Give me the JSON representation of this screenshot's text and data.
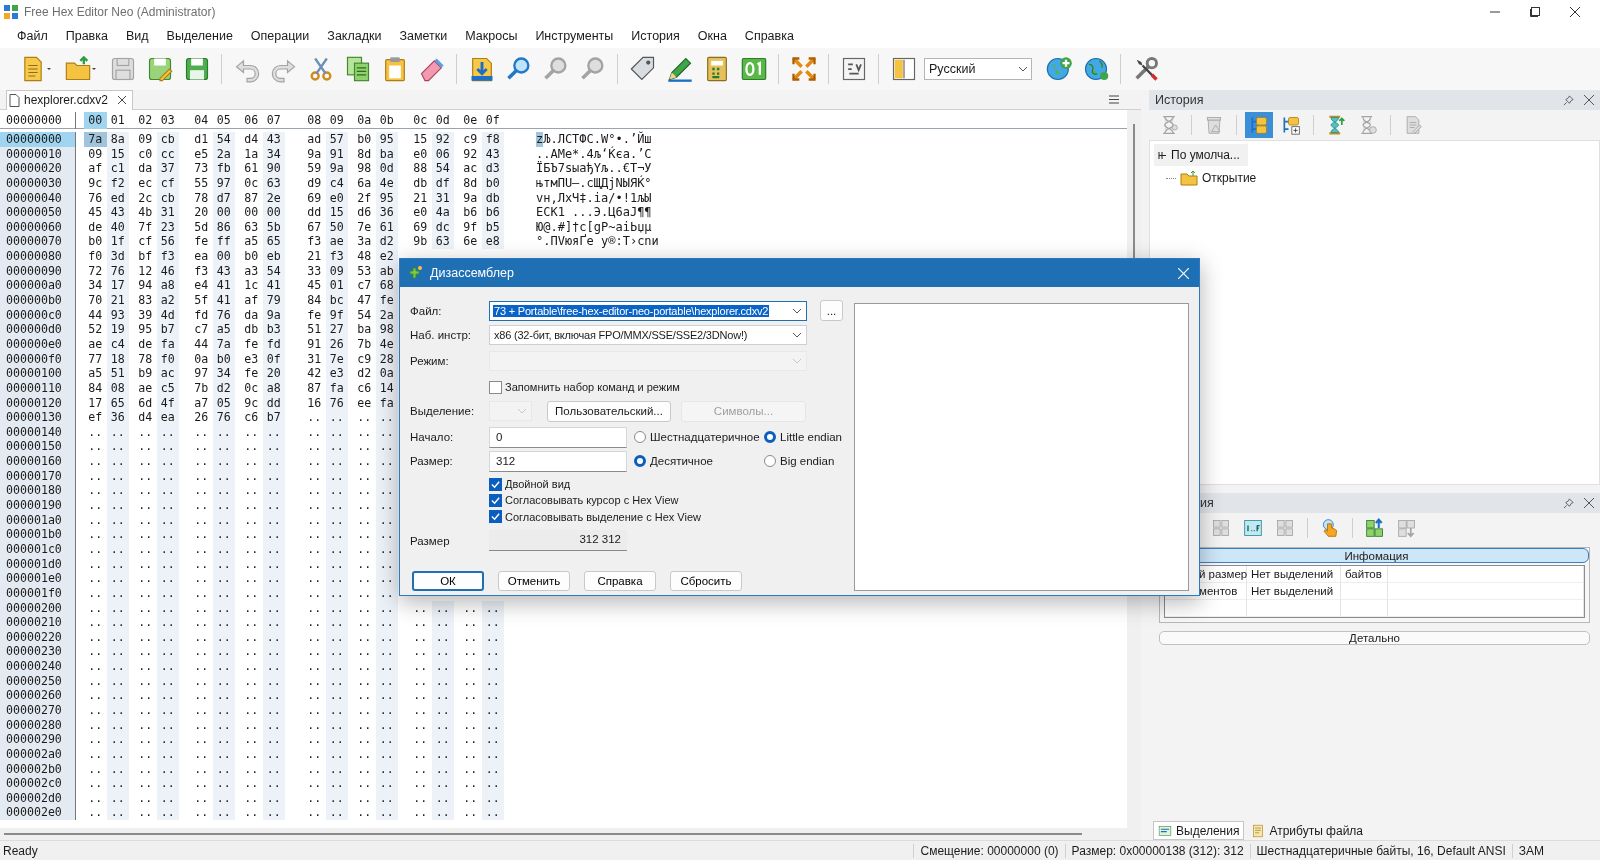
{
  "window": {
    "title": "Free Hex Editor Neo (Administrator)"
  },
  "menu": [
    "Файл",
    "Правка",
    "Вид",
    "Выделение",
    "Операции",
    "Закладки",
    "Заметки",
    "Макросы",
    "Инструменты",
    "История",
    "Окна",
    "Справка"
  ],
  "toolbar": {
    "groups": [
      [
        {
          "kind": "new",
          "disabled": false
        },
        {
          "kind": "caret",
          "disabled": false
        },
        {
          "kind": "open",
          "disabled": false
        },
        {
          "kind": "caret",
          "disabled": false
        },
        {
          "kind": "save",
          "disabled": true
        },
        {
          "kind": "saveas",
          "disabled": false
        },
        {
          "kind": "saveall",
          "disabled": false
        }
      ],
      [
        {
          "kind": "undo",
          "disabled": true
        },
        {
          "kind": "redo",
          "disabled": true
        },
        {
          "kind": "scissors",
          "disabled": false
        },
        {
          "kind": "copy",
          "disabled": false
        },
        {
          "kind": "paste",
          "disabled": false
        },
        {
          "kind": "eraser",
          "disabled": false
        }
      ],
      [
        {
          "kind": "import",
          "disabled": false
        },
        {
          "kind": "search",
          "disabled": false
        },
        {
          "kind": "searchnext",
          "disabled": true
        },
        {
          "kind": "searchprev",
          "disabled": true
        }
      ],
      [
        {
          "kind": "tag",
          "disabled": false
        },
        {
          "kind": "pencil",
          "disabled": false
        },
        {
          "kind": "calculator",
          "disabled": false
        },
        {
          "kind": "binary",
          "disabled": false
        }
      ],
      [
        {
          "kind": "arrows",
          "disabled": false
        }
      ],
      [
        {
          "kind": "figure",
          "disabled": false
        }
      ],
      [
        {
          "kind": "panel",
          "disabled": false
        },
        {
          "kind": "language",
          "disabled": false
        },
        {
          "kind": "globeplus",
          "disabled": false
        },
        {
          "kind": "globe",
          "disabled": false
        }
      ],
      [
        {
          "kind": "tools",
          "disabled": false
        }
      ]
    ],
    "language": "Русский"
  },
  "document_tab": {
    "label": "hexplorer.cdxv2"
  },
  "hex_view": {
    "corner": "00000000",
    "columns": [
      {
        "label": "00",
        "selected": true
      },
      {
        "label": "01",
        "selected": false
      },
      {
        "label": "02",
        "selected": false
      },
      {
        "label": "03",
        "selected": false
      },
      {
        "label": "04",
        "selected": false
      },
      {
        "label": "05",
        "selected": false
      },
      {
        "label": "06",
        "selected": false
      },
      {
        "label": "07",
        "selected": false
      },
      {
        "label": "08",
        "selected": false
      },
      {
        "label": "09",
        "selected": false
      },
      {
        "label": "0a",
        "selected": false
      },
      {
        "label": "0b",
        "selected": false
      },
      {
        "label": "0c",
        "selected": false
      },
      {
        "label": "0d",
        "selected": false
      },
      {
        "label": "0e",
        "selected": false
      },
      {
        "label": "0f",
        "selected": false
      }
    ],
    "rows": [
      {
        "address": "00000000",
        "selected": true,
        "bytes": [
          "7a",
          "8a",
          "09",
          "cb",
          "d1",
          "54",
          "d4",
          "43",
          "ad",
          "57",
          "b0",
          "95",
          "15",
          "92",
          "c9",
          "f8"
        ],
        "text": "zЉ.ЛСТФС.W°•.’Йш"
      },
      {
        "address": "00000010",
        "selected": false,
        "bytes": [
          "09",
          "15",
          "c0",
          "cc",
          "e5",
          "2a",
          "1a",
          "34",
          "9a",
          "91",
          "8d",
          "ba",
          "e0",
          "06",
          "92",
          "43"
        ],
        "text": "..АМе*.4љ‘Ќєa.’C"
      },
      {
        "address": "00000020",
        "selected": false,
        "bytes": [
          "af",
          "c1",
          "da",
          "37",
          "73",
          "fb",
          "61",
          "90",
          "59",
          "9a",
          "98",
          "0d",
          "88",
          "54",
          "ac",
          "d3"
        ],
        "text": "ЇБЪ7sыaђYљ..€Т¬У"
      },
      {
        "address": "00000030",
        "selected": false,
        "bytes": [
          "9c",
          "f2",
          "ec",
          "cf",
          "55",
          "97",
          "0c",
          "63",
          "d9",
          "c4",
          "6a",
          "4e",
          "db",
          "df",
          "8d",
          "b0"
        ],
        "text": "њтмПU–.cЩДjNЫЯЌ°"
      },
      {
        "address": "00000040",
        "selected": false,
        "bytes": [
          "76",
          "ed",
          "2c",
          "cb",
          "78",
          "d7",
          "87",
          "2e",
          "69",
          "e0",
          "2f",
          "95",
          "21",
          "31",
          "9a",
          "db"
        ],
        "text": "vн,ЛхЧ‡.ia/•!1љЫ"
      },
      {
        "address": "00000050",
        "selected": false,
        "bytes": [
          "45",
          "43",
          "4b",
          "31",
          "20",
          "00",
          "00",
          "00",
          "dd",
          "15",
          "d6",
          "36",
          "e0",
          "4a",
          "b6",
          "b6"
        ],
        "text": "ECK1 ...Э.Ц6aJ¶¶"
      },
      {
        "address": "00000060",
        "selected": false,
        "bytes": [
          "de",
          "40",
          "7f",
          "23",
          "5d",
          "86",
          "63",
          "5b",
          "67",
          "50",
          "7e",
          "61",
          "69",
          "dc",
          "9f",
          "b5"
        ],
        "text": "Ю@.#]†c[gP~aiЬџµ"
      },
      {
        "address": "00000070",
        "selected": false,
        "bytes": [
          "b0",
          "1f",
          "cf",
          "56",
          "fe",
          "ff",
          "a5",
          "65",
          "f3",
          "ae",
          "3a",
          "d2",
          "9b",
          "63",
          "6e",
          "e8"
        ],
        "text": "°.ПVюяҐe у®:Т›cnи"
      },
      {
        "address": "00000080",
        "selected": false,
        "bytes": [
          "f0",
          "3d",
          "bf",
          "f3",
          "ea",
          "00",
          "b0",
          "eb",
          "21",
          "f3",
          "48",
          "e2"
        ]
      },
      {
        "address": "00000090",
        "selected": false,
        "bytes": [
          "72",
          "76",
          "12",
          "46",
          "f3",
          "43",
          "a3",
          "54",
          "33",
          "09",
          "53",
          "ab"
        ]
      },
      {
        "address": "000000a0",
        "selected": false,
        "bytes": [
          "34",
          "17",
          "94",
          "a8",
          "e4",
          "41",
          "1c",
          "41",
          "45",
          "01",
          "c7",
          "68"
        ]
      },
      {
        "address": "000000b0",
        "selected": false,
        "bytes": [
          "70",
          "21",
          "83",
          "a2",
          "5f",
          "41",
          "af",
          "79",
          "84",
          "bc",
          "47",
          "fe"
        ]
      },
      {
        "address": "000000c0",
        "selected": false,
        "bytes": [
          "44",
          "93",
          "39",
          "4d",
          "fd",
          "76",
          "da",
          "9a",
          "fe",
          "9f",
          "54",
          "2a"
        ]
      },
      {
        "address": "000000d0",
        "selected": false,
        "bytes": [
          "52",
          "19",
          "95",
          "b7",
          "c7",
          "a5",
          "db",
          "b3",
          "51",
          "27",
          "ba",
          "98"
        ]
      },
      {
        "address": "000000e0",
        "selected": false,
        "bytes": [
          "ae",
          "c4",
          "de",
          "fa",
          "44",
          "7a",
          "fe",
          "fd",
          "91",
          "26",
          "7b",
          "4e"
        ]
      },
      {
        "address": "000000f0",
        "selected": false,
        "bytes": [
          "77",
          "18",
          "78",
          "f0",
          "0a",
          "b0",
          "e3",
          "0f",
          "31",
          "7e",
          "c9",
          "28"
        ]
      },
      {
        "address": "00000100",
        "selected": false,
        "bytes": [
          "a5",
          "51",
          "b9",
          "ac",
          "97",
          "34",
          "fe",
          "20",
          "42",
          "e3",
          "d2",
          "0a"
        ]
      },
      {
        "address": "00000110",
        "selected": false,
        "bytes": [
          "84",
          "08",
          "ae",
          "c5",
          "7b",
          "d2",
          "0c",
          "a8",
          "87",
          "fa",
          "c6",
          "14"
        ]
      },
      {
        "address": "00000120",
        "selected": false,
        "bytes": [
          "17",
          "65",
          "6d",
          "4f",
          "a7",
          "05",
          "9c",
          "dd",
          "16",
          "76",
          "ee",
          "fa"
        ]
      },
      {
        "address": "00000130",
        "selected": false,
        "bytes": [
          "ef",
          "36",
          "d4",
          "ea",
          "26",
          "76",
          "c6",
          "b7",
          "..",
          "..",
          "..",
          ".."
        ]
      },
      {
        "address": "00000140",
        "selected": false,
        "bytes": [
          "..",
          "..",
          "..",
          "..",
          "..",
          "..",
          "..",
          "..",
          "..",
          "..",
          "..",
          ".."
        ]
      },
      {
        "address": "00000150",
        "selected": false,
        "bytes": [
          "..",
          "..",
          "..",
          "..",
          "..",
          "..",
          "..",
          "..",
          "..",
          "..",
          "..",
          ".."
        ]
      },
      {
        "address": "00000160",
        "selected": false,
        "bytes": [
          "..",
          "..",
          "..",
          "..",
          "..",
          "..",
          "..",
          "..",
          "..",
          "..",
          "..",
          ".."
        ]
      },
      {
        "address": "00000170",
        "selected": false,
        "bytes": [
          "..",
          "..",
          "..",
          "..",
          "..",
          "..",
          "..",
          "..",
          "..",
          "..",
          "..",
          ".."
        ]
      },
      {
        "address": "00000180",
        "selected": false,
        "bytes": [
          "..",
          "..",
          "..",
          "..",
          "..",
          "..",
          "..",
          "..",
          "..",
          "..",
          "..",
          ".."
        ]
      },
      {
        "address": "00000190",
        "selected": false,
        "bytes": [
          "..",
          "..",
          "..",
          "..",
          "..",
          "..",
          "..",
          "..",
          "..",
          "..",
          "..",
          ".."
        ]
      },
      {
        "address": "000001a0",
        "selected": false,
        "bytes": [
          "..",
          "..",
          "..",
          "..",
          "..",
          "..",
          "..",
          "..",
          "..",
          "..",
          "..",
          ".."
        ]
      },
      {
        "address": "000001b0",
        "selected": false,
        "bytes": [
          "..",
          "..",
          "..",
          "..",
          "..",
          "..",
          "..",
          "..",
          "..",
          "..",
          "..",
          ".."
        ]
      },
      {
        "address": "000001c0",
        "selected": false,
        "bytes": [
          "..",
          "..",
          "..",
          "..",
          "..",
          "..",
          "..",
          "..",
          "..",
          "..",
          "..",
          ".."
        ]
      },
      {
        "address": "000001d0",
        "selected": false,
        "bytes": [
          "..",
          "..",
          "..",
          "..",
          "..",
          "..",
          "..",
          "..",
          "..",
          "..",
          "..",
          ".."
        ]
      },
      {
        "address": "000001e0",
        "selected": false,
        "bytes": [
          "..",
          "..",
          "..",
          "..",
          "..",
          "..",
          "..",
          "..",
          "..",
          "..",
          "..",
          ".."
        ]
      },
      {
        "address": "000001f0",
        "selected": false,
        "bytes": [
          "..",
          "..",
          "..",
          "..",
          "..",
          "..",
          "..",
          "..",
          "..",
          "..",
          "..",
          ".."
        ]
      },
      {
        "address": "00000200",
        "selected": false,
        "bytes": [
          "..",
          "..",
          "..",
          "..",
          "..",
          "..",
          "..",
          "..",
          "..",
          "..",
          "..",
          "..",
          "..",
          "..",
          "..",
          ".."
        ]
      },
      {
        "address": "00000210",
        "selected": false,
        "bytes": [
          "..",
          "..",
          "..",
          "..",
          "..",
          "..",
          "..",
          "..",
          "..",
          "..",
          "..",
          "..",
          "..",
          "..",
          "..",
          ".."
        ]
      },
      {
        "address": "00000220",
        "selected": false,
        "bytes": [
          "..",
          "..",
          "..",
          "..",
          "..",
          "..",
          "..",
          "..",
          "..",
          "..",
          "..",
          "..",
          "..",
          "..",
          "..",
          ".."
        ]
      },
      {
        "address": "00000230",
        "selected": false,
        "bytes": [
          "..",
          "..",
          "..",
          "..",
          "..",
          "..",
          "..",
          "..",
          "..",
          "..",
          "..",
          "..",
          "..",
          "..",
          "..",
          ".."
        ]
      },
      {
        "address": "00000240",
        "selected": false,
        "bytes": [
          "..",
          "..",
          "..",
          "..",
          "..",
          "..",
          "..",
          "..",
          "..",
          "..",
          "..",
          "..",
          "..",
          "..",
          "..",
          ".."
        ]
      },
      {
        "address": "00000250",
        "selected": false,
        "bytes": [
          "..",
          "..",
          "..",
          "..",
          "..",
          "..",
          "..",
          "..",
          "..",
          "..",
          "..",
          "..",
          "..",
          "..",
          "..",
          ".."
        ]
      },
      {
        "address": "00000260",
        "selected": false,
        "bytes": [
          "..",
          "..",
          "..",
          "..",
          "..",
          "..",
          "..",
          "..",
          "..",
          "..",
          "..",
          "..",
          "..",
          "..",
          "..",
          ".."
        ]
      },
      {
        "address": "00000270",
        "selected": false,
        "bytes": [
          "..",
          "..",
          "..",
          "..",
          "..",
          "..",
          "..",
          "..",
          "..",
          "..",
          "..",
          "..",
          "..",
          "..",
          "..",
          ".."
        ]
      },
      {
        "address": "00000280",
        "selected": false,
        "bytes": [
          "..",
          "..",
          "..",
          "..",
          "..",
          "..",
          "..",
          "..",
          "..",
          "..",
          "..",
          "..",
          "..",
          "..",
          "..",
          ".."
        ]
      },
      {
        "address": "00000290",
        "selected": false,
        "bytes": [
          "..",
          "..",
          "..",
          "..",
          "..",
          "..",
          "..",
          "..",
          "..",
          "..",
          "..",
          "..",
          "..",
          "..",
          "..",
          ".."
        ]
      },
      {
        "address": "000002a0",
        "selected": false,
        "bytes": [
          "..",
          "..",
          "..",
          "..",
          "..",
          "..",
          "..",
          "..",
          "..",
          "..",
          "..",
          "..",
          "..",
          "..",
          "..",
          ".."
        ]
      },
      {
        "address": "000002b0",
        "selected": false,
        "bytes": [
          "..",
          "..",
          "..",
          "..",
          "..",
          "..",
          "..",
          "..",
          "..",
          "..",
          "..",
          "..",
          "..",
          "..",
          "..",
          ".."
        ]
      },
      {
        "address": "000002c0",
        "selected": false,
        "bytes": [
          "..",
          "..",
          "..",
          "..",
          "..",
          "..",
          "..",
          "..",
          "..",
          "..",
          "..",
          "..",
          "..",
          "..",
          "..",
          ".."
        ]
      },
      {
        "address": "000002d0",
        "selected": false,
        "bytes": [
          "..",
          "..",
          "..",
          "..",
          "..",
          "..",
          "..",
          "..",
          "..",
          "..",
          "..",
          "..",
          "..",
          "..",
          "..",
          ".."
        ]
      },
      {
        "address": "000002e0",
        "selected": false,
        "bytes": [
          "..",
          "..",
          "..",
          "..",
          "..",
          "..",
          "..",
          "..",
          "..",
          "..",
          "..",
          "..",
          "..",
          "..",
          "..",
          ".."
        ]
      }
    ]
  },
  "dialog": {
    "title": "Дизассемблер",
    "file": {
      "label": "Файл:",
      "value": "73 + Portable\\free-hex-editor-neo-portable\\hexplorer.cdxv2",
      "highlighted": true,
      "browse": "..."
    },
    "isa": {
      "label": "Наб. инстр:",
      "value": "x86 (32-бит, включая FPO/MMX/SSE/SSE2/3DNow!)"
    },
    "mode": {
      "label": "Режим:",
      "disabled": true
    },
    "remember": {
      "label": "Запомнить набор команд и режим",
      "checked": false
    },
    "selection": {
      "label": "Выделение:",
      "custom": "Пользовательский...",
      "symbols": "Символы...",
      "symbols_disabled": true
    },
    "start": {
      "label": "Начало:",
      "value": "0"
    },
    "size": {
      "label": "Размер:",
      "value": "312"
    },
    "bases": [
      {
        "label": "Шестнадцатеричное",
        "selected": false
      },
      {
        "label": "Десятичное",
        "selected": true
      }
    ],
    "endian": [
      {
        "label": "Little endian",
        "selected": true
      },
      {
        "label": "Big endian",
        "selected": false
      }
    ],
    "options": [
      {
        "label": "Двойной вид",
        "checked": true
      },
      {
        "label": "Согласовывать курсор с Hex View",
        "checked": true
      },
      {
        "label": "Согласовывать выделение с Hex View",
        "checked": true
      }
    ],
    "result": {
      "label": "Размер",
      "value": "312 312"
    },
    "buttons": [
      {
        "label": "ОК",
        "default": true
      },
      {
        "label": "Отменить",
        "default": false
      },
      {
        "label": "Справка",
        "default": false
      },
      {
        "label": "Сбросить",
        "default": false
      }
    ]
  },
  "history_panel": {
    "title": "История",
    "tools": [
      [
        {
          "kind": "hourglass",
          "disabled": true,
          "on": false
        }
      ],
      [
        {
          "kind": "trash",
          "disabled": true,
          "on": false
        }
      ],
      [
        {
          "kind": "branch",
          "disabled": false,
          "on": true
        },
        {
          "kind": "branchplus",
          "disabled": false,
          "on": false
        }
      ],
      [
        {
          "kind": "hourglassup",
          "disabled": false,
          "on": false
        },
        {
          "kind": "hourglassdown",
          "disabled": true,
          "on": false
        }
      ],
      [
        {
          "kind": "report",
          "disabled": true,
          "on": false
        }
      ]
    ],
    "tree": {
      "label": "По умолча...",
      "children": [
        {
          "label": "Открытие"
        }
      ]
    }
  },
  "info_panel": {
    "title": "ия",
    "tools": [
      [
        {
          "kind": "grid",
          "disabled": true,
          "on": false
        },
        {
          "kind": "hexrange",
          "disabled": false,
          "on": false
        },
        {
          "kind": "grid",
          "disabled": true,
          "on": false
        }
      ],
      [
        {
          "kind": "hand",
          "disabled": false,
          "on": false
        }
      ],
      [
        {
          "kind": "gridup",
          "disabled": false,
          "on": false
        },
        {
          "kind": "griddown",
          "disabled": true,
          "on": false
        }
      ]
    ],
    "section": "Инфомация",
    "rows": [
      [
        "й размер",
        "Нет выделений",
        "байтов"
      ],
      [
        "ментов",
        "Нет выделений"
      ]
    ],
    "details": "Детально"
  },
  "bottom_tabs": [
    {
      "label": "Выделения",
      "kind": "selections",
      "selected": true
    },
    {
      "label": "Атрибуты файла",
      "kind": "attributes",
      "selected": false
    }
  ],
  "status_bar": {
    "ready": "Ready",
    "fields": [
      "Смещение: 00000000 (0)",
      "Размер: 0x00000138 (312): 312",
      "Шестнадцатеричные байты, 16, Default ANSI",
      "ЗАМ"
    ]
  }
}
